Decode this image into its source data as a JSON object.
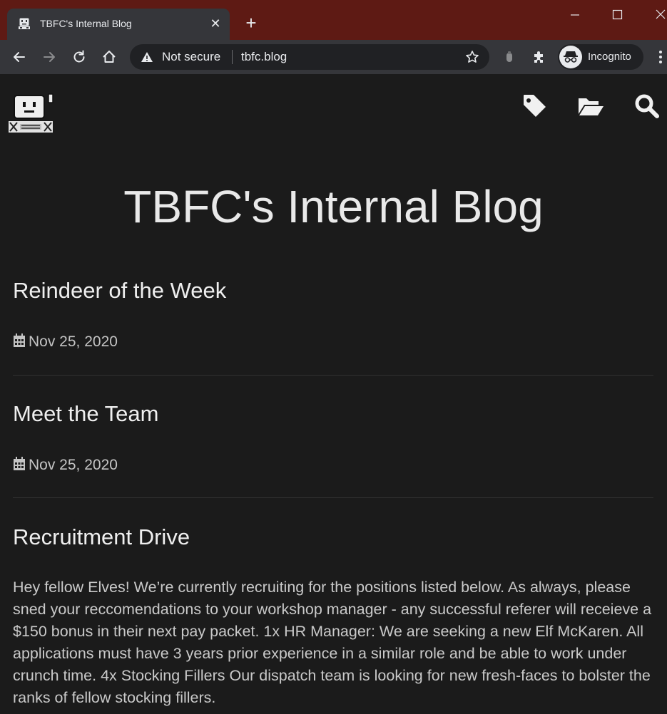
{
  "browser": {
    "tab": {
      "title": "TBFC's Internal Blog"
    },
    "omnibox": {
      "security_label": "Not secure",
      "url": "tbfc.blog"
    },
    "profile": {
      "label": "Incognito"
    },
    "colors": {
      "titlebar": "#5e1a14",
      "toolbar": "#35363a",
      "omnibox": "#202124"
    },
    "icons": [
      "back-arrow-icon",
      "forward-arrow-icon",
      "reload-icon",
      "home-icon",
      "warning-icon",
      "star-icon",
      "extension-icon",
      "puzzle-icon",
      "incognito-icon",
      "menu-dots-icon",
      "minimize-icon",
      "maximize-icon",
      "close-icon",
      "new-tab-icon"
    ]
  },
  "site": {
    "title": "TBFC's Internal Blog",
    "header_icons": [
      "tag-icon",
      "folder-open-icon",
      "search-icon"
    ],
    "background": "#1b1b1b"
  },
  "posts": [
    {
      "title": "Reindeer of the Week",
      "date": "Nov 25, 2020"
    },
    {
      "title": "Meet the Team",
      "date": "Nov 25, 2020"
    },
    {
      "title": "Recruitment Drive",
      "excerpt": "Hey fellow Elves! We’re currently recruiting for the positions listed below. As always, please sned your reccomendations to your workshop manager - any successful referer will receieve a $150 bonus in their next pay packet. 1x HR Manager: We are seeking a new Elf McKaren. All applications must have 3 years prior experience in a similar role and be able to work under crunch time. 4x Stocking Fillers Our dispatch team is looking for new fresh-faces to bolster the ranks of fellow stocking fillers."
    }
  ]
}
